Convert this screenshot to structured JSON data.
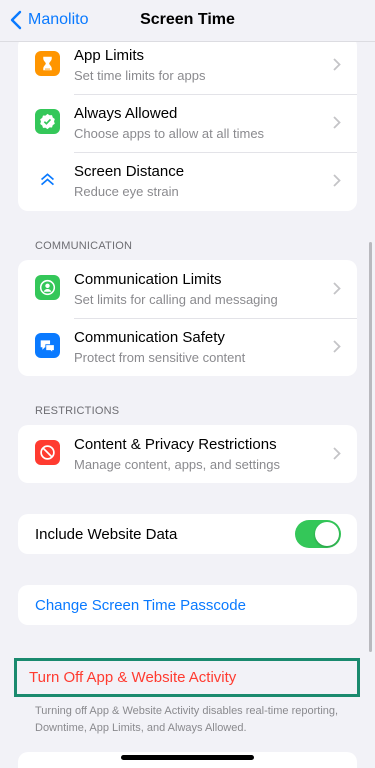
{
  "nav": {
    "back_label": "Manolito",
    "title": "Screen Time"
  },
  "groups": {
    "limits": [
      {
        "title": "App Limits",
        "subtitle": "Set time limits for apps",
        "icon": "hourglass-icon",
        "color": "#ff9500"
      },
      {
        "title": "Always Allowed",
        "subtitle": "Choose apps to allow at all times",
        "icon": "checkmark-seal-icon",
        "color": "#34c759"
      },
      {
        "title": "Screen Distance",
        "subtitle": "Reduce eye strain",
        "icon": "double-chevron-up-icon",
        "color": "#ffffff"
      }
    ],
    "communication_header": "COMMUNICATION",
    "communication": [
      {
        "title": "Communication Limits",
        "subtitle": "Set limits for calling and messaging",
        "icon": "person-circle-icon",
        "color": "#34c759"
      },
      {
        "title": "Communication Safety",
        "subtitle": "Protect from sensitive content",
        "icon": "chat-bubbles-icon",
        "color": "#0a7aff"
      }
    ],
    "restrictions_header": "RESTRICTIONS",
    "restrictions": [
      {
        "title": "Content & Privacy Restrictions",
        "subtitle": "Manage content, apps, and settings",
        "icon": "no-entry-icon",
        "color": "#ff3b30"
      }
    ]
  },
  "website_data": {
    "label": "Include Website Data",
    "enabled": true
  },
  "passcode": {
    "label": "Change Screen Time Passcode"
  },
  "turn_off": {
    "label": "Turn Off App & Website Activity",
    "footnote": "Turning off App & Website Activity disables real-time reporting, Downtime, App Limits, and Always Allowed."
  },
  "colors": {
    "accent": "#0a7aff",
    "destructive": "#ff3b30",
    "toggle_on": "#34c759",
    "highlight_border": "#1a8a6e"
  }
}
